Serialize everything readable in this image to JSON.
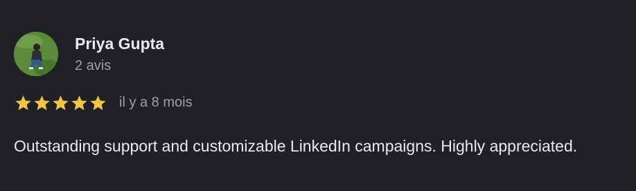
{
  "review": {
    "reviewer_name": "Priya Gupta",
    "review_count": "2 avis",
    "rating": 5,
    "rating_max": 5,
    "date": "il y a 8 mois",
    "text": "Outstanding support and customizable LinkedIn campaigns. Highly appreciated."
  },
  "colors": {
    "background": "#202124",
    "star": "#f5c442",
    "primary_text": "#e8eaed",
    "secondary_text": "#9aa0a6"
  },
  "icons": {
    "avatar": "reviewer-photo",
    "star": "star-icon"
  }
}
